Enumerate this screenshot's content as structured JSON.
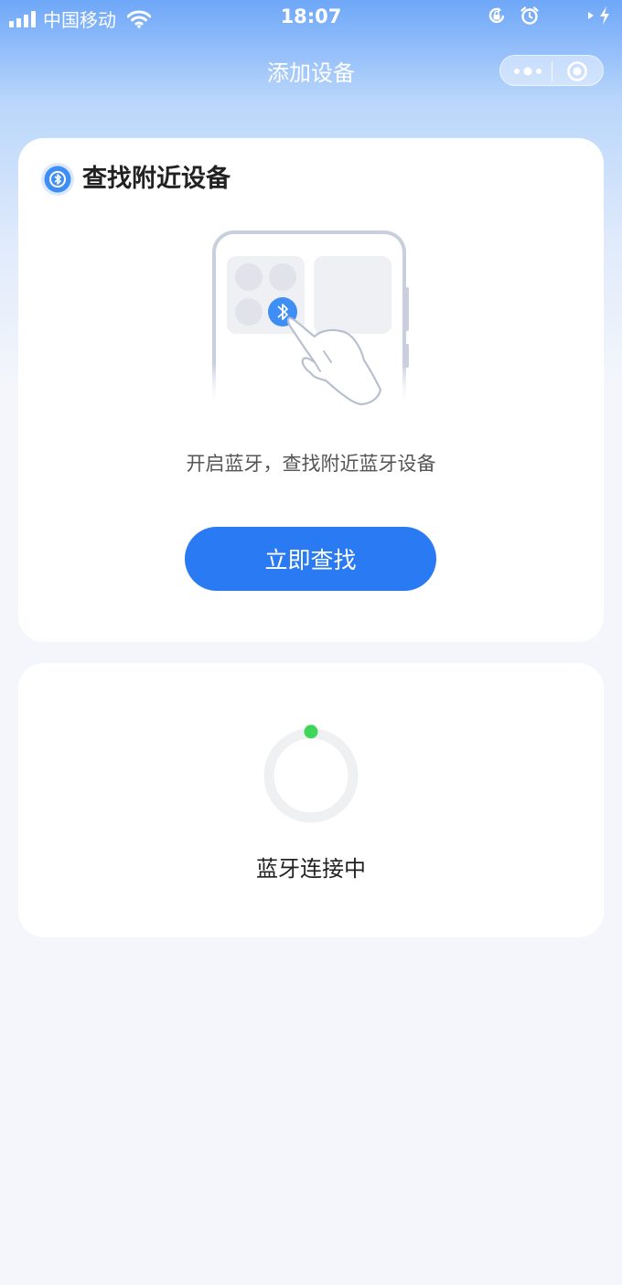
{
  "status_bar": {
    "carrier": "中国移动",
    "time": "18:07",
    "icons": [
      "signal-icon",
      "wifi-icon",
      "rotation-lock-icon",
      "alarm-icon",
      "location-arrow-icon",
      "charging-icon"
    ]
  },
  "nav": {
    "title": "添加设备",
    "icons": [
      "more-dots-icon",
      "close-target-icon"
    ]
  },
  "find_card": {
    "title": "查找附近设备",
    "description": "开启蓝牙，查找附近蓝牙设备",
    "button_label": "立即查找",
    "icons": [
      "bluetooth-search-icon",
      "phone-bluetooth-illustration",
      "bluetooth-icon",
      "pointing-hand-icon"
    ]
  },
  "connect_card": {
    "status": "蓝牙连接中",
    "icons": [
      "loading-spinner-icon"
    ]
  },
  "colors": {
    "accent": "#2a7af3",
    "spinner_dot": "#3ed65a",
    "card_bg": "#ffffff",
    "page_bg": "#f4f6fb"
  }
}
